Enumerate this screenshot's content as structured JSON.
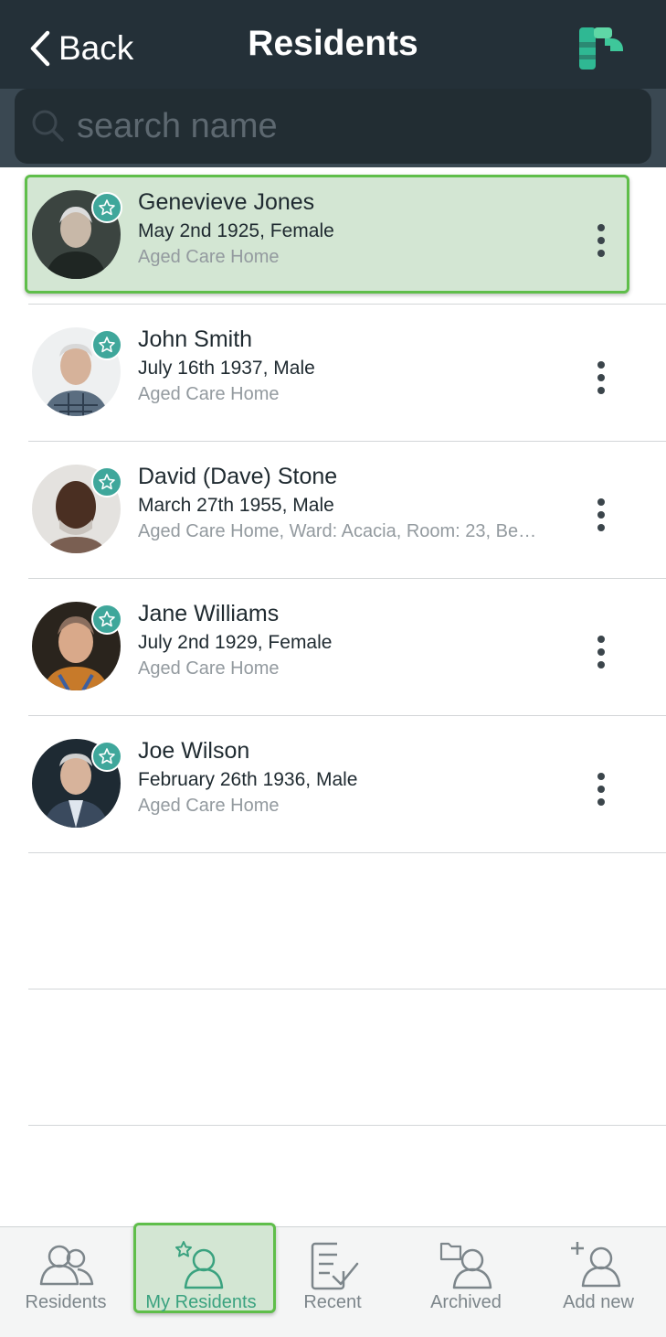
{
  "header": {
    "back_label": "Back",
    "title": "Residents",
    "logo_icon": "app-logo-icon"
  },
  "search": {
    "placeholder": "search name",
    "icon": "search-icon"
  },
  "residents": [
    {
      "name": "Genevieve Jones",
      "dob": "May  2nd 1925, Female",
      "location": "Aged Care Home",
      "selected": true
    },
    {
      "name": "John Smith",
      "dob": "July 16th 1937, Male",
      "location": "Aged Care Home",
      "selected": false
    },
    {
      "name": "David (Dave) Stone",
      "dob": "March 27th 1955, Male",
      "location": "Aged Care Home, Ward: Acacia, Room: 23, Be…",
      "selected": false
    },
    {
      "name": "Jane Williams",
      "dob": "July 2nd 1929, Female",
      "location": "Aged Care Home",
      "selected": false
    },
    {
      "name": "Joe Wilson",
      "dob": "February 26th 1936, Male",
      "location": "Aged Care Home",
      "selected": false
    }
  ],
  "tabs": [
    {
      "label": "Residents",
      "icon": "residents-icon",
      "active": false
    },
    {
      "label": "My Residents",
      "icon": "my-residents-icon",
      "active": true
    },
    {
      "label": "Recent",
      "icon": "recent-icon",
      "active": false
    },
    {
      "label": "Archived",
      "icon": "archived-icon",
      "active": false
    },
    {
      "label": "Add new",
      "icon": "add-new-icon",
      "active": false
    }
  ],
  "colors": {
    "header_bg": "#243038",
    "accent_green": "#5fbe4a",
    "badge_teal": "#3fa79b",
    "selected_bg": "#d3e6d3"
  }
}
